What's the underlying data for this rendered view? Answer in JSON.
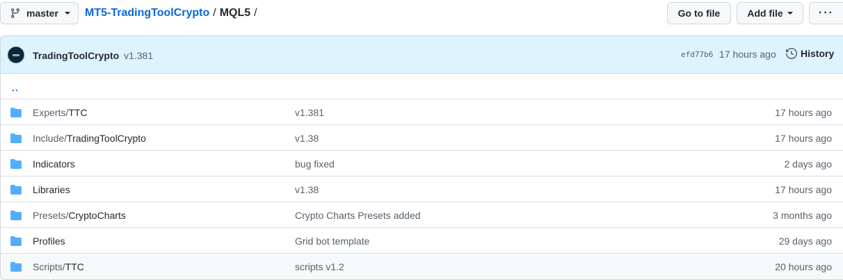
{
  "branch": {
    "label": "master"
  },
  "breadcrumb": {
    "repo": "MT5-TradingToolCrypto",
    "sep1": "/",
    "current": "MQL5",
    "sep2": "/"
  },
  "actions": {
    "go_to_file": "Go to file",
    "add_file": "Add file",
    "more": "···"
  },
  "commit": {
    "author": "TradingToolCrypto",
    "message": "v1.381",
    "sha": "efd77b6",
    "time": "17 hours ago",
    "history_label": "History"
  },
  "parent_dir": "..",
  "files": [
    {
      "prefix": "Experts/",
      "name": "TTC",
      "message": "v1.381",
      "age": "17 hours ago"
    },
    {
      "prefix": "Include/",
      "name": "TradingToolCrypto",
      "message": "v1.38",
      "age": "17 hours ago"
    },
    {
      "prefix": "",
      "name": "Indicators",
      "message": "bug fixed",
      "age": "2 days ago"
    },
    {
      "prefix": "",
      "name": "Libraries",
      "message": "v1.38",
      "age": "17 hours ago"
    },
    {
      "prefix": "Presets/",
      "name": "CryptoCharts",
      "message": "Crypto Charts Presets added",
      "age": "3 months ago"
    },
    {
      "prefix": "",
      "name": "Profiles",
      "message": "Grid bot template",
      "age": "29 days ago"
    },
    {
      "prefix": "Scripts/",
      "name": "TTC",
      "message": "scripts v1.2",
      "age": "20 hours ago"
    }
  ],
  "colors": {
    "link": "#0969da",
    "folder": "#54aeff",
    "commit_bg": "#ddf4ff"
  },
  "icons": {
    "branch": "git-branch-icon",
    "folder": "folder-icon",
    "history": "history-icon"
  }
}
